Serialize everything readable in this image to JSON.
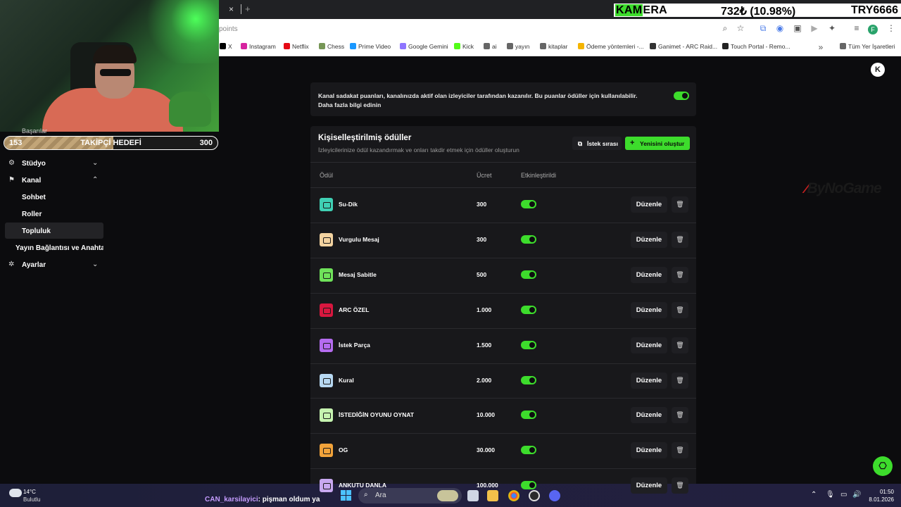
{
  "browser": {
    "tab_close": "×",
    "url_partial": "points",
    "bookmarks": [
      {
        "label": "X",
        "color": "#000000"
      },
      {
        "label": "Instagram",
        "color": "#d6249f"
      },
      {
        "label": "Netflix",
        "color": "#e50914"
      },
      {
        "label": "Chess",
        "color": "#769656"
      },
      {
        "label": "Prime Video",
        "color": "#1a98ff"
      },
      {
        "label": "Google Gemini",
        "color": "#8e75ff"
      },
      {
        "label": "Kick",
        "color": "#53fc18"
      },
      {
        "label": "ai",
        "color": "#666666"
      },
      {
        "label": "yayın",
        "color": "#666666"
      },
      {
        "label": "kitaplar",
        "color": "#666666"
      },
      {
        "label": "Ödeme yöntemleri -...",
        "color": "#f4b400"
      },
      {
        "label": "Ganimet - ARC Raid...",
        "color": "#333333"
      },
      {
        "label": "Touch Portal - Remo...",
        "color": "#222222"
      },
      {
        "label": "Tüm Yer İşaretleri",
        "color": "#666666"
      }
    ]
  },
  "ticker": {
    "name_hl": "KAM",
    "name_rest": "ERA",
    "price": "732₺ (10.98%)",
    "symbol": "TRY6666"
  },
  "follower_goal": {
    "current": "153",
    "label": "TAKİPÇİ HEDEFİ",
    "target": "300",
    "progress": 0.51
  },
  "sidebar": {
    "partial_item": "Başarılar",
    "items": [
      {
        "label": "Stüdyo",
        "icon": "studio-icon",
        "chevron": "down"
      },
      {
        "label": "Kanal",
        "icon": "channel-icon",
        "chevron": "up"
      },
      {
        "label": "Sohbet"
      },
      {
        "label": "Roller"
      },
      {
        "label": "Topluluk",
        "active": true
      },
      {
        "label": "Yayın Bağlantısı ve Anahtarı"
      },
      {
        "label": "Ayarlar",
        "icon": "gear-icon",
        "chevron": "down"
      }
    ]
  },
  "info": {
    "text": "Kanal sadakat puanları, kanalınızda aktif olan izleyiciler tarafından kazanılır. Bu puanlar ödüller için kullanılabilir.",
    "link": "Daha fazla bilgi edinin",
    "enabled": true
  },
  "rewards": {
    "title": "Kişiselleştirilmiş ödüller",
    "subtitle": "İzleyicilerinize ödül kazandırmak ve onları takdir etmek için ödüller oluşturun",
    "queue_button": "İstek sırası",
    "create_button": "Yenisini oluştur",
    "columns": {
      "reward": "Ödül",
      "cost": "Ücret",
      "enabled": "Etkinleştirildi"
    },
    "edit_label": "Düzenle",
    "rows": [
      {
        "name": "Su-Dik",
        "cost": "300",
        "color": "#3fd0b4",
        "enabled": true
      },
      {
        "name": "Vurgulu Mesaj",
        "cost": "300",
        "color": "#f3d3a0",
        "enabled": true
      },
      {
        "name": "Mesaj Sabitle",
        "cost": "500",
        "color": "#6fe25a",
        "enabled": true
      },
      {
        "name": "ARC ÖZEL",
        "cost": "1.000",
        "color": "#d8173f",
        "enabled": true
      },
      {
        "name": "İstek Parça",
        "cost": "1.500",
        "color": "#b56cf0",
        "enabled": true
      },
      {
        "name": "Kural",
        "cost": "2.000",
        "color": "#b7d8f2",
        "enabled": true
      },
      {
        "name": "İSTEDİĞİN OYUNU OYNAT",
        "cost": "10.000",
        "color": "#c6f3b0",
        "enabled": true
      },
      {
        "name": "OG",
        "cost": "30.000",
        "color": "#f2a33a",
        "enabled": true
      },
      {
        "name": "ANKUTU DANLA",
        "cost": "100.000",
        "color": "#c8a8f0",
        "enabled": true
      }
    ]
  },
  "brand": {
    "pre": "ByNoGame"
  },
  "taskbar": {
    "temp": "14°C",
    "weather": "Bulutlu",
    "chat_user": "CAN_karsilayici",
    "chat_msg": ": pişman oldum ya",
    "search_placeholder": "Ara",
    "time": "01:50",
    "date": "8.01.2026"
  }
}
